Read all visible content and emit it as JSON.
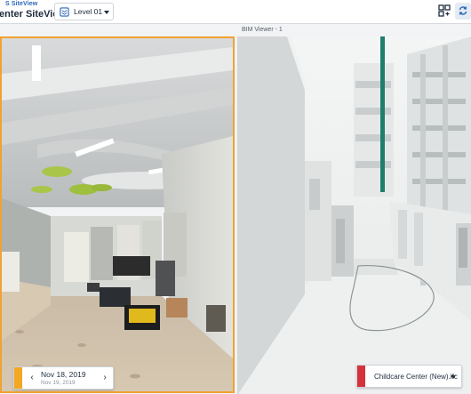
{
  "header": {
    "app_subtitle": "S SiteView",
    "app_title": "enter SiteView",
    "level_select": {
      "value": "Level 01",
      "icon": "layers-icon"
    },
    "grid_icon": "split-view-icon",
    "sync_icon": "sync-icon"
  },
  "photo_viewer": {
    "date_selector": {
      "current_date": "Nov 18, 2019",
      "next_date": "Nov 19, 2019",
      "prev_icon": "chevron-left-icon",
      "next_icon": "chevron-right-icon"
    }
  },
  "bim_viewer": {
    "title": "BIM Viewer - 1",
    "model_select": {
      "value": "Childcare Center (New).ifc"
    }
  },
  "colors": {
    "accent_orange": "#f5a623",
    "model_red": "#d6323c",
    "brand_blue": "#2a67b8"
  }
}
